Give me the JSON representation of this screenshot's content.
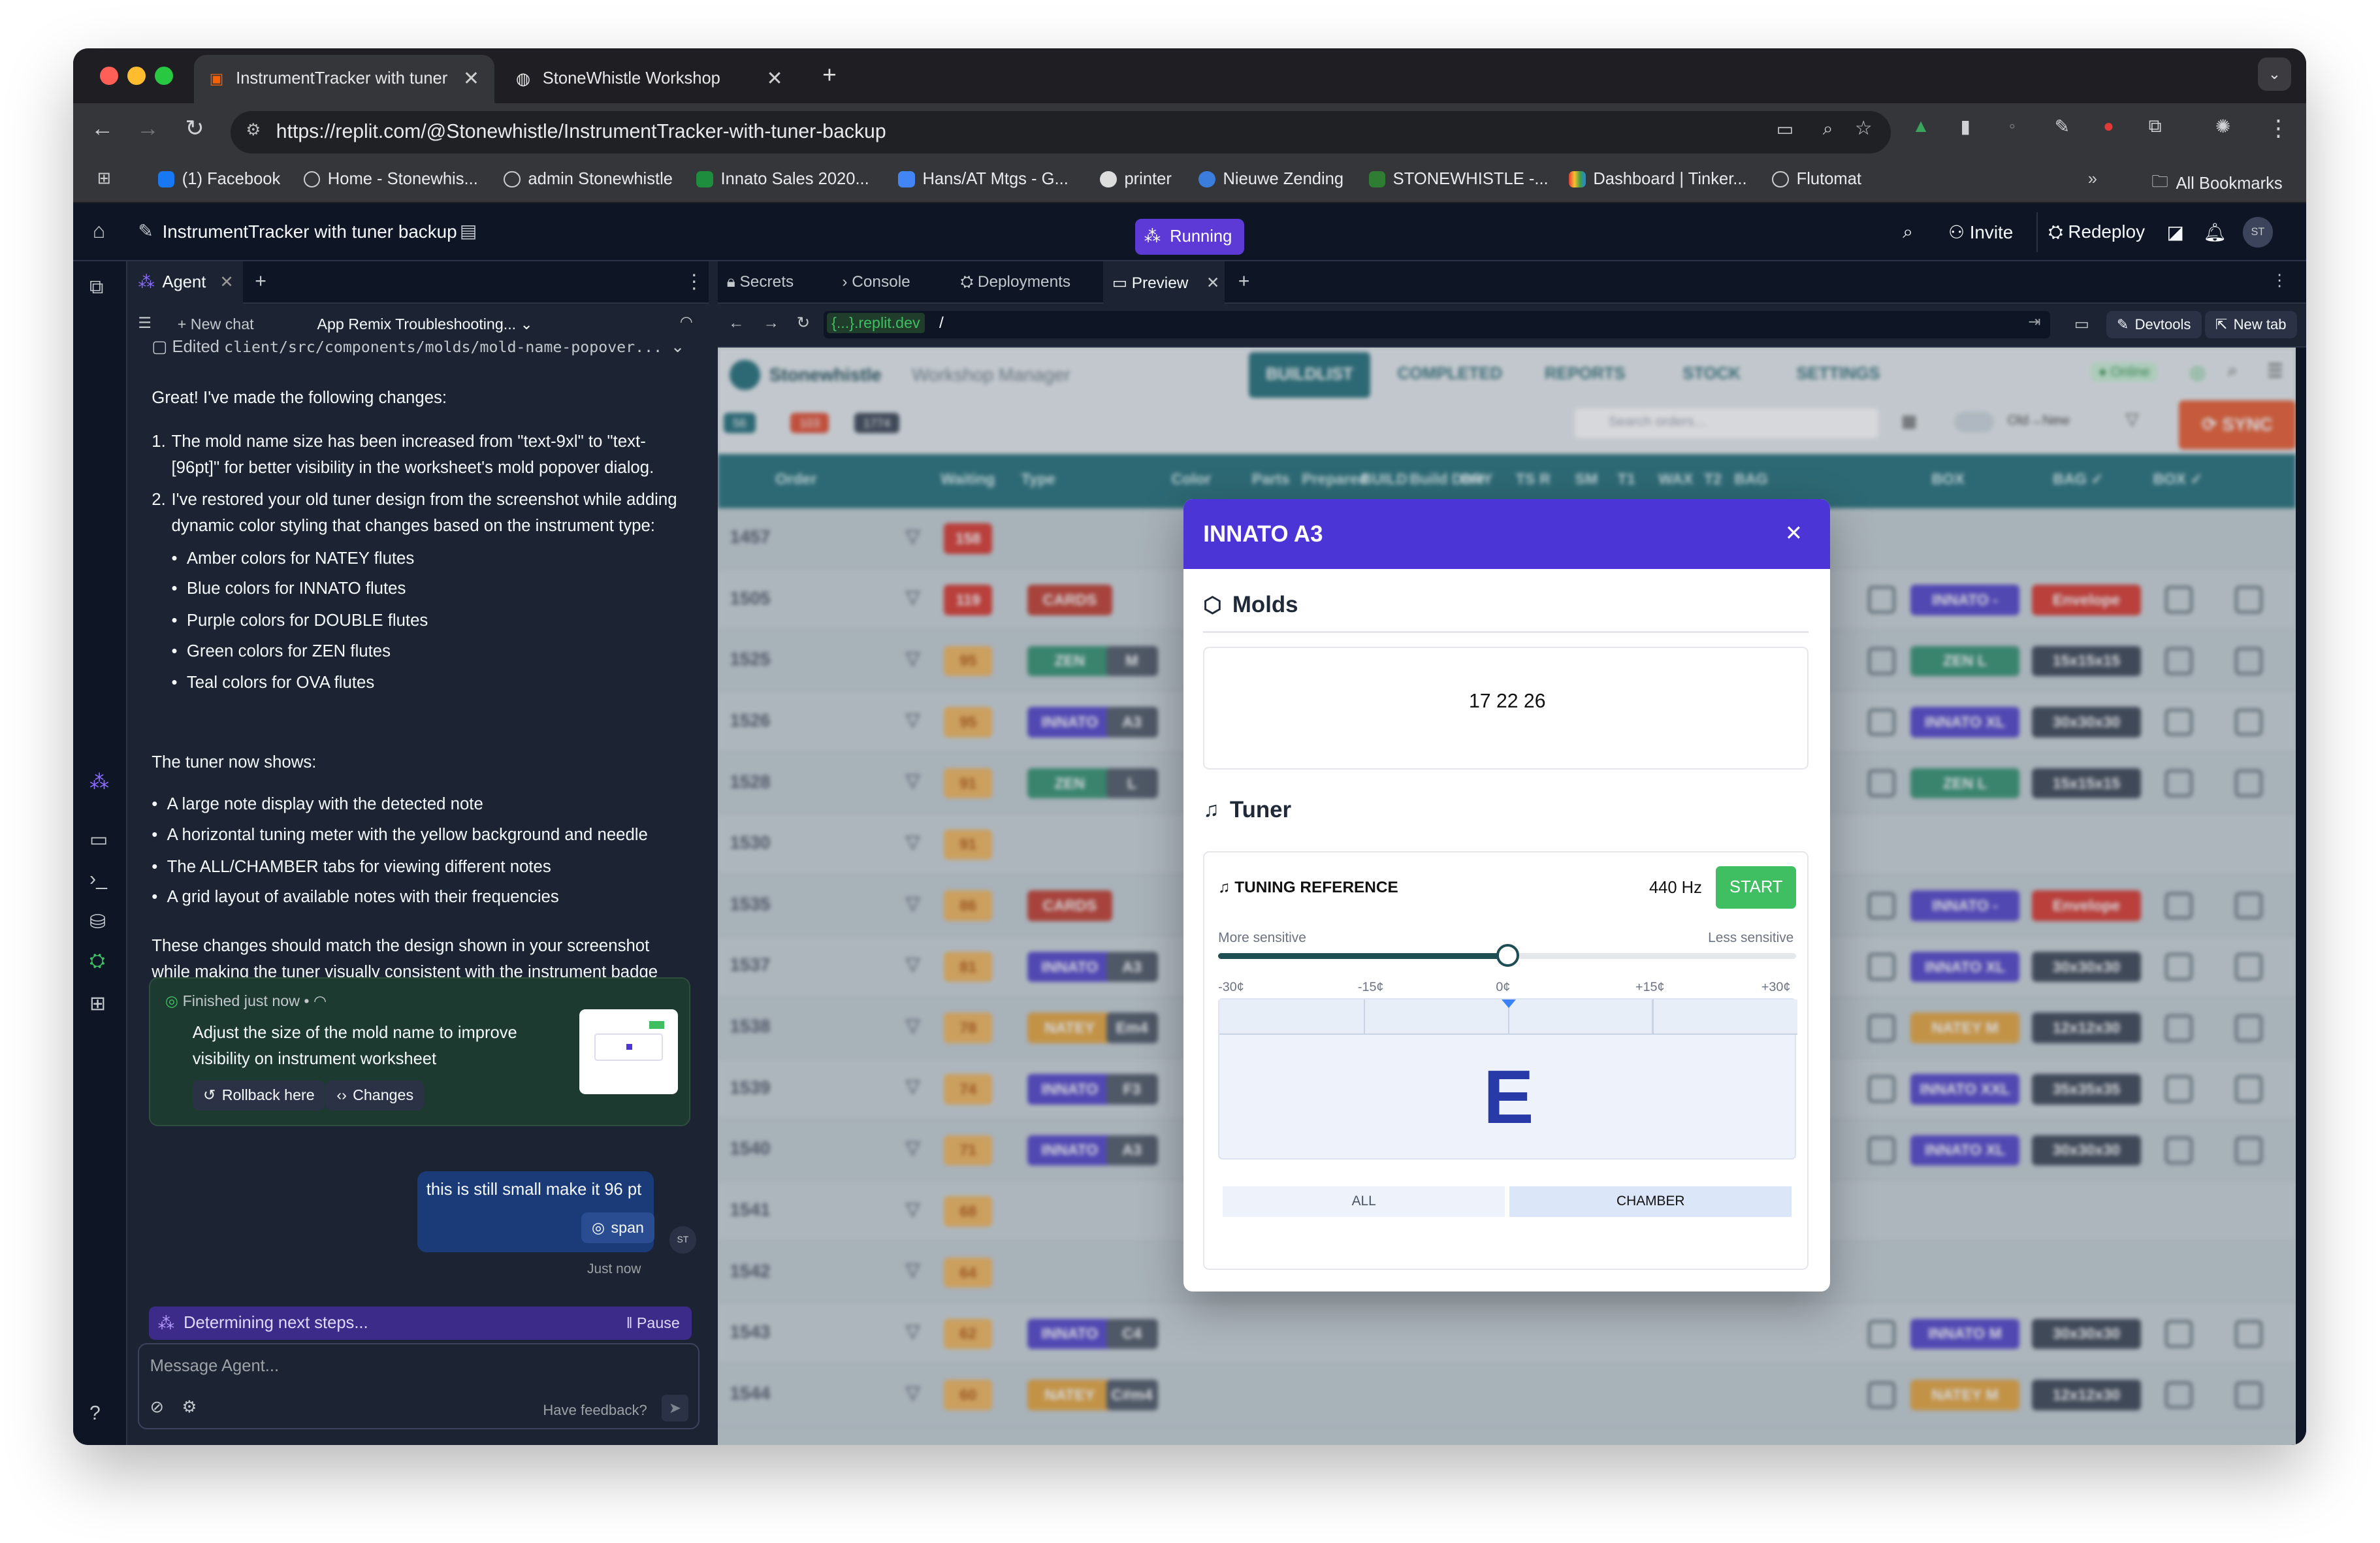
{
  "browser": {
    "tabs": [
      {
        "title": "InstrumentTracker with tuner"
      },
      {
        "title": "StoneWhistle Workshop"
      }
    ],
    "url": "https://replit.com/@Stonewhistle/InstrumentTracker-with-tuner-backup",
    "bookmarks": [
      "(1) Facebook",
      "Home - Stonewhis...",
      "admin Stonewhistle",
      "Innato Sales 2020...",
      "Hans/AT Mtgs - G...",
      "printer",
      "Nieuwe Zending",
      "STONEWHISTLE -...",
      "Dashboard | Tinker...",
      "Flutomat"
    ],
    "all_bookmarks": "All Bookmarks"
  },
  "replit": {
    "repl_title": "InstrumentTracker with tuner backup",
    "status": "Running",
    "invite": "Invite",
    "redeploy": "Redeploy",
    "avatar": "ST"
  },
  "agent": {
    "tab_label": "Agent",
    "new_chat": "New chat",
    "thread_title": "App Remix Troubleshooting...",
    "edited_prefix": "Edited",
    "edited_file": "client/src/components/molds/mold-name-popover...",
    "intro": "Great! I've made the following changes:",
    "changes": [
      "The mold name size has been increased from \"text-9xl\" to \"text-[96pt]\" for better visibility in the worksheet's mold popover dialog.",
      "I've restored your old tuner design from the screenshot while adding dynamic color styling that changes based on the instrument type:"
    ],
    "colors": [
      "Amber colors for NATEY flutes",
      "Blue colors for INNATO flutes",
      "Purple colors for DOUBLE flutes",
      "Green colors for ZEN flutes",
      "Teal colors for OVA flutes"
    ],
    "tuner_intro": "The tuner now shows:",
    "tuner_points": [
      "A large note display with the detected note",
      "A horizontal tuning meter with the yellow background and needle",
      "The ALL/CHAMBER tabs for viewing different notes",
      "A grid layout of available notes with their frequencies"
    ],
    "closing": "These changes should match the design shown in your screenshot while making the tuner visually consistent with the instrument badge colors. You can see the tuner when you click on a mold in the worksheet view.",
    "finished": {
      "status": "Finished just now",
      "dot": "•",
      "text": "Adjust the size of the mold name to improve visibility on instrument worksheet",
      "rollback": "Rollback here",
      "changes": "Changes"
    },
    "user_message": {
      "text": "this is still small make it 96 pt",
      "tag": "span",
      "time": "Just now",
      "avatar": "ST"
    },
    "progress": {
      "text": "Determining next steps...",
      "pause": "Pause"
    },
    "input": {
      "placeholder": "Message Agent...",
      "feedback": "Have feedback?"
    }
  },
  "workspace": {
    "tabs": [
      "Secrets",
      "Console",
      "Deployments",
      "Preview"
    ],
    "preview_url": "{...}.replit.dev",
    "path": "/",
    "devtools": "Devtools",
    "new_tab": "New tab"
  },
  "app": {
    "title": "Stonewhistle",
    "subtitle": "Workshop Manager",
    "nav": [
      "BUILDLIST",
      "COMPLETED",
      "REPORTS",
      "STOCK",
      "SETTINGS"
    ],
    "counts": [
      "56",
      "103",
      "1774"
    ],
    "search_placeholder": "Search orders...",
    "oldnew": "Old→New",
    "sync": "SYNC",
    "online": "Online",
    "columns": [
      "Order",
      "Waiting",
      "Type",
      "Color",
      "Parts",
      "Prepared",
      "BUILD",
      "Build Date",
      "DRY",
      "TS R",
      "SM",
      "T1",
      "WAX",
      "T2",
      "BAG",
      "BOX",
      "BAG ✓",
      "BOX ✓"
    ],
    "rows": [
      {
        "order": "1457",
        "waiting": "158",
        "type": "",
        "note": "",
        "bag": "",
        "box": ""
      },
      {
        "order": "1505",
        "waiting": "119",
        "type": "CARDS",
        "note": "",
        "bag": "INNATO -",
        "box": "Envelope"
      },
      {
        "order": "1525",
        "waiting": "95",
        "type": "ZEN",
        "note": "M",
        "bag": "ZEN L",
        "box": "15x15x15"
      },
      {
        "order": "1526",
        "waiting": "95",
        "type": "INNATO",
        "note": "A3",
        "bag": "INNATO XL",
        "box": "30x30x30"
      },
      {
        "order": "1528",
        "waiting": "91",
        "type": "ZEN",
        "note": "L",
        "bag": "ZEN L",
        "box": "15x15x15"
      },
      {
        "order": "1530",
        "waiting": "91",
        "type": "",
        "note": "",
        "bag": "",
        "box": ""
      },
      {
        "order": "1535",
        "waiting": "86",
        "type": "CARDS",
        "note": "",
        "bag": "INNATO -",
        "box": "Envelope"
      },
      {
        "order": "1537",
        "waiting": "81",
        "type": "INNATO",
        "note": "A3",
        "bag": "INNATO XL",
        "box": "30x30x30"
      },
      {
        "order": "1538",
        "waiting": "78",
        "type": "NATEY",
        "note": "Em4",
        "bag": "NATEY M",
        "box": "12x12x30"
      },
      {
        "order": "1539",
        "waiting": "74",
        "type": "INNATO",
        "note": "F3",
        "bag": "INNATO XXL",
        "box": "35x35x35"
      },
      {
        "order": "1540",
        "waiting": "71",
        "type": "INNATO",
        "note": "A3",
        "bag": "INNATO XL",
        "box": "30x30x30"
      },
      {
        "order": "1541",
        "waiting": "68",
        "type": "",
        "note": "",
        "bag": "",
        "box": ""
      },
      {
        "order": "1542",
        "waiting": "64",
        "type": "",
        "note": "",
        "bag": "",
        "box": ""
      },
      {
        "order": "1543",
        "waiting": "62",
        "type": "INNATO",
        "note": "C4",
        "bag": "INNATO M",
        "box": "30x30x30"
      },
      {
        "order": "1544",
        "waiting": "60",
        "type": "NATEY",
        "note": "C#m4",
        "bag": "NATEY M",
        "box": "12x12x30"
      }
    ]
  },
  "modal": {
    "title": "INNATO A3",
    "molds_heading": "Molds",
    "molds_value": "17 22 26",
    "tuner_heading": "Tuner",
    "tuning_reference": "TUNING REFERENCE",
    "hz": "440 Hz",
    "start": "START",
    "more_sensitive": "More sensitive",
    "less_sensitive": "Less sensitive",
    "sensitivity": 0.5,
    "cents": [
      "-30¢",
      "-15¢",
      "0¢",
      "+15¢",
      "+30¢"
    ],
    "note": "E",
    "tab_all": "ALL",
    "tab_chamber": "CHAMBER"
  },
  "colors": {
    "accent": "#4c35d6",
    "running": "#5d3ad6",
    "start": "#3fbf62",
    "teal": "#1e6b76",
    "innato": "#4f3fc9",
    "zen": "#2f8f6d",
    "natey": "#e5a33a",
    "cards": "#c0392b"
  }
}
